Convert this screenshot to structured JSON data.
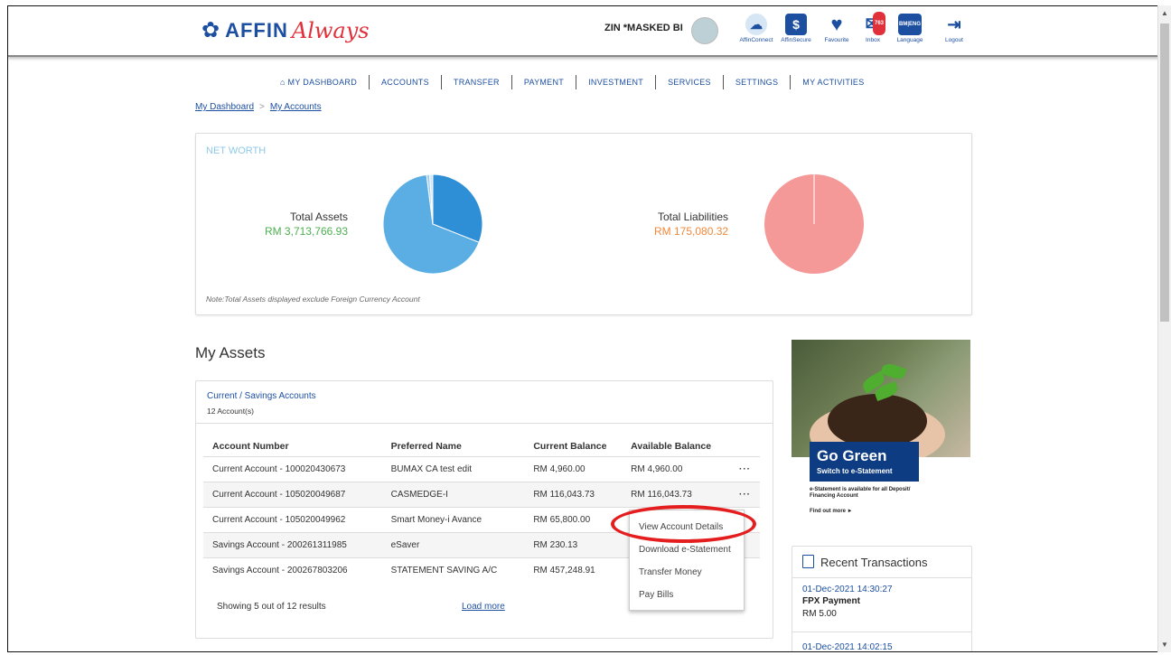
{
  "header": {
    "brand": "AFFIN",
    "brand_script": "Always",
    "user_name": "ZIN *MASKED BI",
    "icons": [
      {
        "label": "AffinConnect",
        "icon": "affinconnect-icon"
      },
      {
        "label": "AffinSecure",
        "icon": "shield-dollar-icon"
      },
      {
        "label": "Favourite",
        "icon": "heart-icon"
      },
      {
        "label": "Inbox",
        "icon": "envelope-icon",
        "badge": "763"
      },
      {
        "label": "Language",
        "icon": "language-icon",
        "glyph": "BM|ENG"
      },
      {
        "label": "Logout",
        "icon": "logout-door-icon"
      }
    ]
  },
  "nav": {
    "items": [
      "MY DASHBOARD",
      "ACCOUNTS",
      "TRANSFER",
      "PAYMENT",
      "INVESTMENT",
      "SERVICES",
      "SETTINGS",
      "MY ACTIVITIES"
    ]
  },
  "breadcrumb": {
    "home": "My Dashboard",
    "separator": ">",
    "current": "My Accounts"
  },
  "networth": {
    "title": "NET WORTH",
    "assets_label": "Total Assets",
    "assets_value": "RM 3,713,766.93",
    "liabilities_label": "Total Liabilities",
    "liabilities_value": "RM 175,080.32",
    "note": "Note:Total Assets displayed exclude Foreign Currency Account"
  },
  "chart_data": [
    {
      "type": "pie",
      "slices": [
        {
          "value": 0.31,
          "color": "#2e8fd6"
        },
        {
          "value": 0.67,
          "color": "#5aaee3"
        },
        {
          "value": 0.01,
          "color": "#9fcdf0"
        },
        {
          "value": 0.01,
          "color": "#cfe6f8"
        }
      ]
    },
    {
      "type": "pie",
      "slices": [
        {
          "value": 1.0,
          "color": "#f59898"
        }
      ]
    }
  ],
  "assets": {
    "title": "My Assets",
    "group_title": "Current / Savings Accounts",
    "group_count": "12 Account(s)",
    "columns": [
      "Account Number",
      "Preferred Name",
      "Current Balance",
      "Available Balance"
    ],
    "rows": [
      {
        "account": "Current Account - 100020430673",
        "name": "BUMAX CA test edit",
        "current": "RM 4,960.00",
        "available": "RM 4,960.00",
        "more": "···"
      },
      {
        "account": "Current Account - 105020049687",
        "name": "CASMEDGE-I",
        "current": "RM 116,043.73",
        "available": "RM 116,043.73",
        "more": "···"
      },
      {
        "account": "Current Account - 105020049962",
        "name": "Smart Money-i Avance",
        "current": "RM 65,800.00",
        "available": "",
        "more": ""
      },
      {
        "account": "Savings Account - 200261311985",
        "name": "eSaver",
        "current": "RM 230.13",
        "available": "",
        "more": ""
      },
      {
        "account": "Savings Account - 200267803206",
        "name": "STATEMENT SAVING A/C",
        "current": "RM 457,248.91",
        "available": "",
        "more": ""
      }
    ],
    "showing": "Showing 5 out of 12 results",
    "load_more": "Load more"
  },
  "context_menu": {
    "items": [
      "View Account Details",
      "Download e-Statement",
      "Transfer Money",
      "Pay Bills"
    ]
  },
  "banner": {
    "title": "Go Green",
    "subtitle": "Switch to e-Statement",
    "text": "e-Statement is available for all Deposit/ Financing Account",
    "link": "Find out more ►"
  },
  "recent": {
    "title": "Recent Transactions",
    "items": [
      {
        "date": "01-Dec-2021 14:30:27",
        "name": "FPX Payment",
        "amount": "RM 5.00"
      },
      {
        "date": "01-Dec-2021 14:02:15"
      }
    ]
  },
  "colors": {
    "primary": "#1d4fa1",
    "accent_red": "#e0303a",
    "assets_green": "#4caf50",
    "liabilities_orange": "#f0883a"
  }
}
